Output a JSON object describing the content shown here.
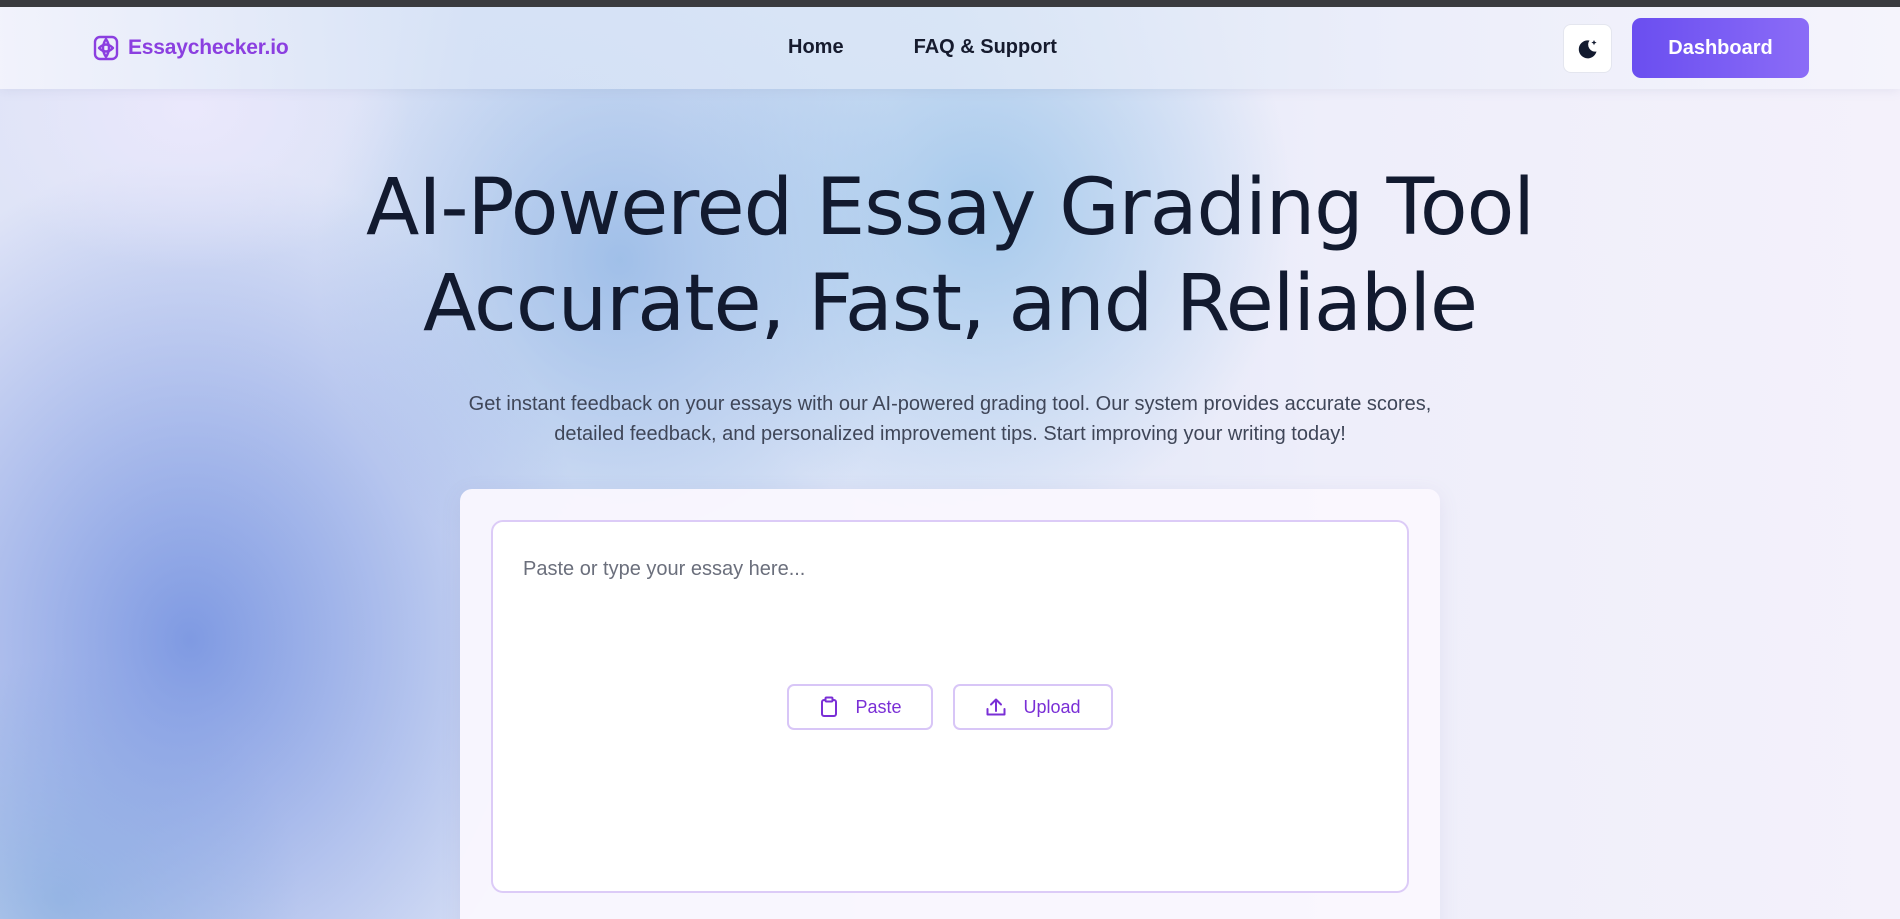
{
  "brand": {
    "name": "Essaychecker.io",
    "color": "#8b3fe0"
  },
  "nav": {
    "links": [
      "Home",
      "FAQ & Support"
    ],
    "theme_toggle_icon": "moon-icon",
    "dashboard_label": "Dashboard"
  },
  "hero": {
    "title_line1": "AI-Powered Essay Grading Tool",
    "title_line2": "Accurate, Fast, and Reliable",
    "subtitle_line1": "Get instant feedback on your essays with our AI-powered grading tool. Our system provides accurate scores,",
    "subtitle_line2": "detailed feedback, and personalized improvement tips. Start improving your writing today!"
  },
  "editor": {
    "placeholder": "Paste or type your essay here...",
    "value": "",
    "paste_label": "Paste",
    "paste_icon": "clipboard-icon",
    "upload_label": "Upload",
    "upload_icon": "upload-icon"
  },
  "colors": {
    "accent": "#7a2fd6",
    "button_gradient_start": "#6a4ef0",
    "button_gradient_end": "#8b6cf7",
    "heading": "#121a2f"
  }
}
